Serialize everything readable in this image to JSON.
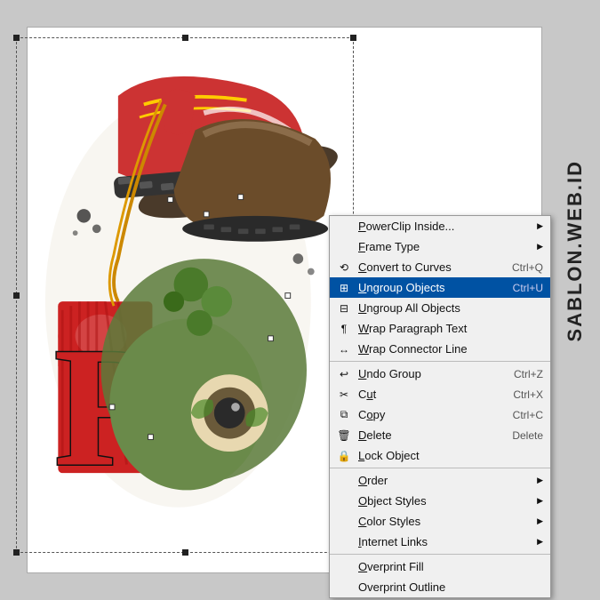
{
  "canvas": {
    "bg_color": "#c8c8c8",
    "page_bg": "#ffffff"
  },
  "watermark": {
    "text": "SABLON.WEB.ID"
  },
  "context_menu": {
    "items": [
      {
        "id": "powerclip",
        "label": "PowerClip Inside...",
        "shortcut": "",
        "has_arrow": true,
        "has_icon": false,
        "separator_before": false,
        "highlighted": false
      },
      {
        "id": "frame-type",
        "label": "Frame Type",
        "shortcut": "",
        "has_arrow": true,
        "has_icon": false,
        "separator_before": false,
        "highlighted": false
      },
      {
        "id": "convert-curves",
        "label": "Convert to Curves",
        "shortcut": "Ctrl+Q",
        "has_arrow": false,
        "has_icon": true,
        "separator_before": false,
        "highlighted": false
      },
      {
        "id": "ungroup-objects",
        "label": "Ungroup Objects",
        "shortcut": "Ctrl+U",
        "has_arrow": false,
        "has_icon": true,
        "separator_before": false,
        "highlighted": true
      },
      {
        "id": "ungroup-all",
        "label": "Ungroup All Objects",
        "shortcut": "",
        "has_arrow": false,
        "has_icon": true,
        "separator_before": false,
        "highlighted": false
      },
      {
        "id": "wrap-paragraph",
        "label": "Wrap Paragraph Text",
        "shortcut": "",
        "has_arrow": false,
        "has_icon": true,
        "separator_before": false,
        "highlighted": false
      },
      {
        "id": "wrap-connector",
        "label": "Wrap Connector Line",
        "shortcut": "",
        "has_arrow": false,
        "has_icon": true,
        "separator_before": false,
        "highlighted": false
      },
      {
        "id": "undo-group",
        "label": "Undo Group",
        "shortcut": "Ctrl+Z",
        "has_arrow": false,
        "has_icon": true,
        "separator_before": true,
        "highlighted": false
      },
      {
        "id": "cut",
        "label": "Cut",
        "shortcut": "Ctrl+X",
        "has_arrow": false,
        "has_icon": true,
        "separator_before": false,
        "highlighted": false
      },
      {
        "id": "copy",
        "label": "Copy",
        "shortcut": "Ctrl+C",
        "has_arrow": false,
        "has_icon": true,
        "separator_before": false,
        "highlighted": false
      },
      {
        "id": "delete",
        "label": "Delete",
        "shortcut": "Delete",
        "has_arrow": false,
        "has_icon": true,
        "separator_before": false,
        "highlighted": false
      },
      {
        "id": "lock-object",
        "label": "Lock Object",
        "shortcut": "",
        "has_arrow": false,
        "has_icon": true,
        "separator_before": false,
        "highlighted": false
      },
      {
        "id": "order",
        "label": "Order",
        "shortcut": "",
        "has_arrow": true,
        "has_icon": false,
        "separator_before": true,
        "highlighted": false
      },
      {
        "id": "object-styles",
        "label": "Object Styles",
        "shortcut": "",
        "has_arrow": true,
        "has_icon": false,
        "separator_before": false,
        "highlighted": false
      },
      {
        "id": "color-styles",
        "label": "Color Styles",
        "shortcut": "",
        "has_arrow": true,
        "has_icon": false,
        "separator_before": false,
        "highlighted": false
      },
      {
        "id": "internet-links",
        "label": "Internet Links",
        "shortcut": "",
        "has_arrow": true,
        "has_icon": false,
        "separator_before": false,
        "highlighted": false
      },
      {
        "id": "overprint-fill",
        "label": "Overprint Fill",
        "shortcut": "",
        "has_arrow": false,
        "has_icon": false,
        "separator_before": true,
        "highlighted": false
      },
      {
        "id": "overprint-outline",
        "label": "Overprint Outline",
        "shortcut": "",
        "has_arrow": false,
        "has_icon": false,
        "separator_before": false,
        "highlighted": false
      }
    ]
  }
}
